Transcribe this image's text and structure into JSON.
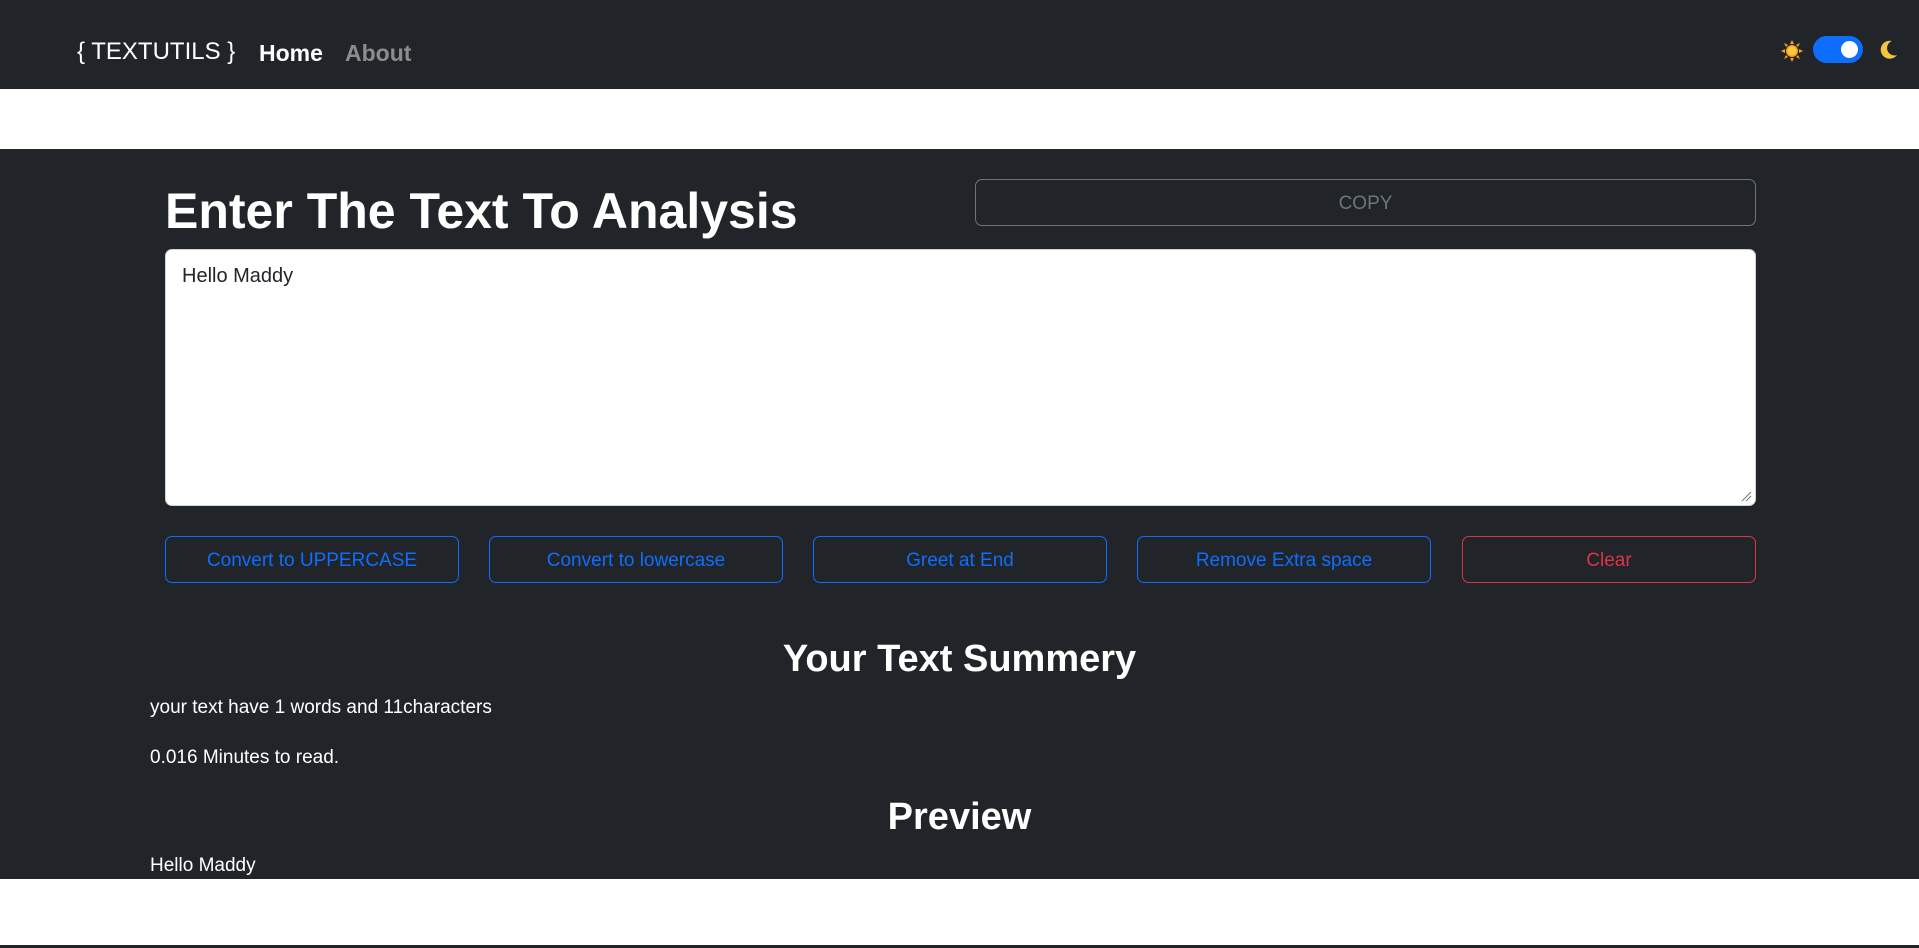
{
  "navbar": {
    "brand": "{ TEXTUTILS }",
    "links": [
      {
        "label": "Home",
        "active": true
      },
      {
        "label": "About",
        "active": false
      }
    ],
    "theme_toggle": {
      "on": true,
      "left_icon": "sun-icon",
      "right_icon": "moon-icon",
      "accent_color": "#0d6efd"
    }
  },
  "editor": {
    "title": "Enter The Text To Analysis",
    "copy_label": "COPY",
    "text_value": "Hello Maddy"
  },
  "actions": {
    "uppercase_label": "Convert to UPPERCASE",
    "lowercase_label": "Convert to lowercase",
    "greet_label": "Greet at End",
    "remove_space_label": "Remove Extra space",
    "clear_label": "Clear"
  },
  "summary": {
    "title": "Your Text Summery",
    "counts_line": "your text have 1 words and 11characters",
    "read_time_line": "0.016 Minutes to read."
  },
  "preview": {
    "title": "Preview",
    "text": "Hello Maddy"
  },
  "colors": {
    "dark_bg": "#212529",
    "primary": "#0d6efd",
    "danger": "#dc3545",
    "muted": "#6c757d"
  }
}
